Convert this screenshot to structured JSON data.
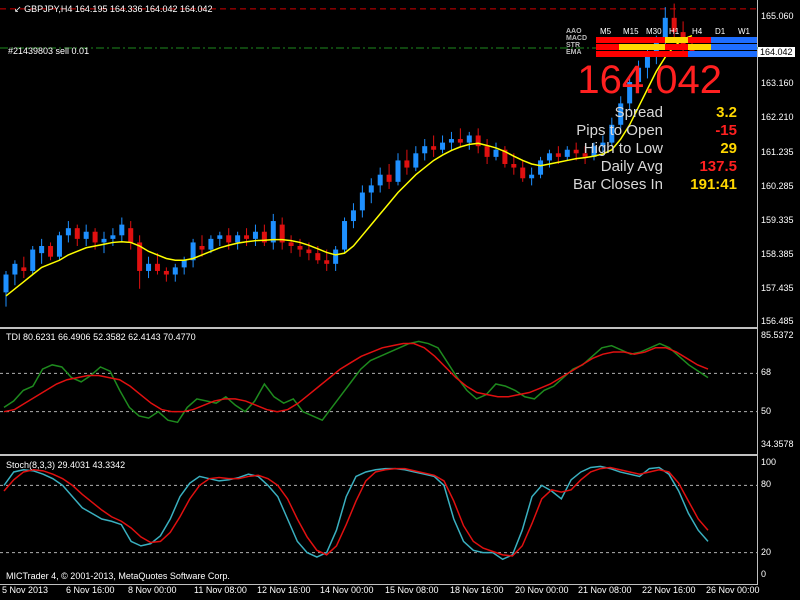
{
  "chart_data": {
    "type": "candlestick",
    "symbol_header": "GBPJPY,H4  164.195 164.336 164.042 164.042",
    "ylim": [
      156.3,
      165.5
    ],
    "y_ticks": [
      "165.060",
      "164.042",
      "163.160",
      "162.210",
      "161.235",
      "160.285",
      "159.335",
      "158.385",
      "157.435",
      "156.485"
    ],
    "x_ticks": [
      "5 Nov 2013",
      "6 Nov 16:00",
      "8 Nov 00:00",
      "11 Nov 08:00",
      "12 Nov 16:00",
      "14 Nov 00:00",
      "15 Nov 08:00",
      "18 Nov 16:00",
      "20 Nov 00:00",
      "21 Nov 08:00",
      "22 Nov 16:00",
      "26 Nov 00:00"
    ],
    "current_price": "164.042",
    "trade_label": "#21439803 sell 0.01",
    "candles": [
      {
        "o": 157.3,
        "h": 157.9,
        "l": 156.9,
        "c": 157.8
      },
      {
        "o": 157.8,
        "h": 158.2,
        "l": 157.5,
        "c": 158.1
      },
      {
        "o": 158.0,
        "h": 158.3,
        "l": 157.7,
        "c": 157.9
      },
      {
        "o": 157.9,
        "h": 158.6,
        "l": 157.8,
        "c": 158.5
      },
      {
        "o": 158.4,
        "h": 158.8,
        "l": 158.1,
        "c": 158.6
      },
      {
        "o": 158.6,
        "h": 158.7,
        "l": 158.2,
        "c": 158.3
      },
      {
        "o": 158.3,
        "h": 159.0,
        "l": 158.2,
        "c": 158.9
      },
      {
        "o": 158.9,
        "h": 159.3,
        "l": 158.7,
        "c": 159.1
      },
      {
        "o": 159.1,
        "h": 159.2,
        "l": 158.6,
        "c": 158.8
      },
      {
        "o": 158.8,
        "h": 159.2,
        "l": 158.6,
        "c": 159.0
      },
      {
        "o": 159.0,
        "h": 159.1,
        "l": 158.5,
        "c": 158.7
      },
      {
        "o": 158.7,
        "h": 159.0,
        "l": 158.4,
        "c": 158.8
      },
      {
        "o": 158.8,
        "h": 159.1,
        "l": 158.6,
        "c": 158.9
      },
      {
        "o": 158.9,
        "h": 159.4,
        "l": 158.7,
        "c": 159.2
      },
      {
        "o": 159.1,
        "h": 159.3,
        "l": 158.5,
        "c": 158.7
      },
      {
        "o": 158.7,
        "h": 158.9,
        "l": 157.4,
        "c": 157.9
      },
      {
        "o": 157.9,
        "h": 158.3,
        "l": 157.7,
        "c": 158.1
      },
      {
        "o": 158.1,
        "h": 158.4,
        "l": 157.8,
        "c": 157.9
      },
      {
        "o": 157.9,
        "h": 158.0,
        "l": 157.6,
        "c": 157.8
      },
      {
        "o": 157.8,
        "h": 158.1,
        "l": 157.6,
        "c": 158.0
      },
      {
        "o": 158.0,
        "h": 158.3,
        "l": 157.8,
        "c": 158.2
      },
      {
        "o": 158.2,
        "h": 158.8,
        "l": 158.0,
        "c": 158.7
      },
      {
        "o": 158.6,
        "h": 158.9,
        "l": 158.3,
        "c": 158.5
      },
      {
        "o": 158.5,
        "h": 158.9,
        "l": 158.4,
        "c": 158.8
      },
      {
        "o": 158.8,
        "h": 159.0,
        "l": 158.6,
        "c": 158.9
      },
      {
        "o": 158.9,
        "h": 159.1,
        "l": 158.5,
        "c": 158.7
      },
      {
        "o": 158.7,
        "h": 159.0,
        "l": 158.5,
        "c": 158.9
      },
      {
        "o": 158.9,
        "h": 159.1,
        "l": 158.6,
        "c": 158.8
      },
      {
        "o": 158.8,
        "h": 159.2,
        "l": 158.6,
        "c": 159.0
      },
      {
        "o": 159.0,
        "h": 159.2,
        "l": 158.6,
        "c": 158.7
      },
      {
        "o": 158.7,
        "h": 159.5,
        "l": 158.5,
        "c": 159.3
      },
      {
        "o": 159.2,
        "h": 159.4,
        "l": 158.5,
        "c": 158.7
      },
      {
        "o": 158.7,
        "h": 158.9,
        "l": 158.4,
        "c": 158.6
      },
      {
        "o": 158.6,
        "h": 158.8,
        "l": 158.3,
        "c": 158.5
      },
      {
        "o": 158.5,
        "h": 158.7,
        "l": 158.2,
        "c": 158.4
      },
      {
        "o": 158.4,
        "h": 158.6,
        "l": 158.1,
        "c": 158.2
      },
      {
        "o": 158.2,
        "h": 158.5,
        "l": 157.9,
        "c": 158.1
      },
      {
        "o": 158.1,
        "h": 158.6,
        "l": 157.9,
        "c": 158.5
      },
      {
        "o": 158.5,
        "h": 159.4,
        "l": 158.4,
        "c": 159.3
      },
      {
        "o": 159.3,
        "h": 159.8,
        "l": 159.1,
        "c": 159.6
      },
      {
        "o": 159.6,
        "h": 160.3,
        "l": 159.4,
        "c": 160.1
      },
      {
        "o": 160.1,
        "h": 160.5,
        "l": 159.8,
        "c": 160.3
      },
      {
        "o": 160.3,
        "h": 160.8,
        "l": 160.1,
        "c": 160.6
      },
      {
        "o": 160.6,
        "h": 160.9,
        "l": 160.2,
        "c": 160.4
      },
      {
        "o": 160.4,
        "h": 161.2,
        "l": 160.3,
        "c": 161.0
      },
      {
        "o": 161.0,
        "h": 161.3,
        "l": 160.6,
        "c": 160.8
      },
      {
        "o": 160.8,
        "h": 161.4,
        "l": 160.7,
        "c": 161.2
      },
      {
        "o": 161.2,
        "h": 161.6,
        "l": 161.0,
        "c": 161.4
      },
      {
        "o": 161.4,
        "h": 161.7,
        "l": 161.1,
        "c": 161.3
      },
      {
        "o": 161.3,
        "h": 161.7,
        "l": 161.2,
        "c": 161.5
      },
      {
        "o": 161.5,
        "h": 161.8,
        "l": 161.3,
        "c": 161.6
      },
      {
        "o": 161.6,
        "h": 161.9,
        "l": 161.4,
        "c": 161.5
      },
      {
        "o": 161.5,
        "h": 161.8,
        "l": 161.3,
        "c": 161.7
      },
      {
        "o": 161.7,
        "h": 161.9,
        "l": 161.2,
        "c": 161.4
      },
      {
        "o": 161.4,
        "h": 161.6,
        "l": 160.9,
        "c": 161.1
      },
      {
        "o": 161.1,
        "h": 161.5,
        "l": 161.0,
        "c": 161.3
      },
      {
        "o": 161.3,
        "h": 161.4,
        "l": 160.8,
        "c": 160.9
      },
      {
        "o": 160.9,
        "h": 161.2,
        "l": 160.6,
        "c": 160.8
      },
      {
        "o": 160.8,
        "h": 161.0,
        "l": 160.4,
        "c": 160.5
      },
      {
        "o": 160.5,
        "h": 160.8,
        "l": 160.3,
        "c": 160.6
      },
      {
        "o": 160.6,
        "h": 161.1,
        "l": 160.5,
        "c": 161.0
      },
      {
        "o": 161.0,
        "h": 161.3,
        "l": 160.8,
        "c": 161.2
      },
      {
        "o": 161.2,
        "h": 161.4,
        "l": 160.9,
        "c": 161.1
      },
      {
        "o": 161.1,
        "h": 161.4,
        "l": 161.0,
        "c": 161.3
      },
      {
        "o": 161.3,
        "h": 161.5,
        "l": 161.0,
        "c": 161.2
      },
      {
        "o": 161.2,
        "h": 161.4,
        "l": 160.9,
        "c": 161.1
      },
      {
        "o": 161.1,
        "h": 161.5,
        "l": 161.0,
        "c": 161.4
      },
      {
        "o": 161.4,
        "h": 161.7,
        "l": 161.2,
        "c": 161.5
      },
      {
        "o": 161.5,
        "h": 162.2,
        "l": 161.4,
        "c": 162.0
      },
      {
        "o": 162.0,
        "h": 162.8,
        "l": 161.9,
        "c": 162.6
      },
      {
        "o": 162.6,
        "h": 163.4,
        "l": 162.4,
        "c": 163.2
      },
      {
        "o": 163.2,
        "h": 163.8,
        "l": 163.0,
        "c": 163.6
      },
      {
        "o": 163.6,
        "h": 164.2,
        "l": 163.3,
        "c": 164.0
      },
      {
        "o": 164.0,
        "h": 164.5,
        "l": 163.7,
        "c": 164.3
      },
      {
        "o": 164.3,
        "h": 165.3,
        "l": 164.1,
        "c": 165.0
      },
      {
        "o": 165.0,
        "h": 165.4,
        "l": 164.4,
        "c": 164.6
      },
      {
        "o": 164.6,
        "h": 164.9,
        "l": 164.0,
        "c": 164.2
      },
      {
        "o": 164.2,
        "h": 164.4,
        "l": 163.9,
        "c": 164.04
      }
    ],
    "ma_line": [
      157.2,
      157.4,
      157.6,
      157.8,
      158.0,
      158.1,
      158.2,
      158.35,
      158.45,
      158.55,
      158.6,
      158.65,
      158.7,
      158.72,
      158.7,
      158.6,
      158.45,
      158.35,
      158.25,
      158.2,
      158.2,
      158.25,
      158.35,
      158.45,
      158.55,
      158.62,
      158.68,
      158.72,
      158.75,
      158.76,
      158.78,
      158.78,
      158.75,
      158.7,
      158.62,
      158.52,
      158.42,
      158.35,
      158.4,
      158.6,
      158.9,
      159.2,
      159.5,
      159.8,
      160.1,
      160.35,
      160.6,
      160.8,
      161.0,
      161.15,
      161.28,
      161.38,
      161.45,
      161.48,
      161.42,
      161.35,
      161.25,
      161.12,
      161.0,
      160.9,
      160.85,
      160.9,
      160.95,
      161.0,
      161.05,
      161.08,
      161.12,
      161.18,
      161.3,
      161.6,
      162.0,
      162.5,
      163.0,
      163.5,
      163.9,
      164.2,
      164.4,
      164.5
    ],
    "info_panel": {
      "price": "164.042",
      "rows": [
        {
          "label": "Spread",
          "value": "3.2",
          "color": "#ffd700"
        },
        {
          "label": "Pips to Open",
          "value": "-15",
          "color": "#ff2020"
        },
        {
          "label": "High to Low",
          "value": "29",
          "color": "#ffd700"
        },
        {
          "label": "Daily Avg",
          "value": "137.5",
          "color": "#ff2020"
        },
        {
          "label": "Bar Closes In",
          "value": "191:41",
          "color": "#ffd700"
        }
      ]
    },
    "mtf_panel": {
      "timeframes": [
        "M5",
        "M15",
        "M30",
        "H1",
        "H4",
        "D1",
        "W1"
      ],
      "rows": [
        {
          "label": "AAO",
          "cells": [
            "#000000",
            "#000000",
            "#000000",
            "#000000",
            "#000000",
            "#000000",
            "#000000"
          ]
        },
        {
          "label": "MACD",
          "cells": [
            "#ff0000",
            "#ff0000",
            "#ff0000",
            "#ffd700",
            "#ff0000",
            "#1e6eff",
            "#1e6eff"
          ]
        },
        {
          "label": "STR",
          "cells": [
            "#ff0000",
            "#ffd700",
            "#ffd700",
            "#ff0000",
            "#ffd700",
            "#1e6eff",
            "#1e6eff"
          ]
        },
        {
          "label": "EMA",
          "cells": [
            "#ff0000",
            "#ff0000",
            "#ff0000",
            "#ff0000",
            "#1e6eff",
            "#1e6eff",
            "#1e6eff"
          ]
        }
      ]
    }
  },
  "tdi": {
    "header": "TDI 80.6231 66.4906 52.3582 62.4143 70.4770",
    "y_ticks": [
      "85.5372",
      "68",
      "50",
      "34.3578"
    ],
    "ylim": [
      34.3578,
      85.5372
    ],
    "levels": [
      68,
      50
    ],
    "green": [
      52,
      55,
      60,
      62,
      70,
      72,
      71,
      66,
      64,
      67,
      71,
      69,
      60,
      52,
      48,
      47,
      50,
      46,
      45,
      52,
      56,
      55,
      54,
      57,
      53,
      50,
      55,
      63,
      57,
      54,
      56,
      50,
      48,
      46,
      52,
      58,
      64,
      70,
      74,
      76,
      78,
      80,
      82,
      83,
      82,
      80,
      73,
      66,
      60,
      56,
      58,
      63,
      62,
      60,
      57,
      56,
      60,
      62,
      66,
      70,
      72,
      76,
      80,
      81,
      79,
      77,
      78,
      80,
      82,
      80,
      76,
      72,
      69,
      66
    ],
    "red": [
      50,
      51,
      54,
      57,
      60,
      63,
      65,
      66,
      67,
      67,
      66,
      65,
      62,
      58,
      54,
      51,
      50,
      50,
      51,
      53,
      55,
      56,
      56,
      55,
      53,
      51,
      50,
      51,
      54,
      58,
      62,
      66,
      70,
      73,
      76,
      78,
      80,
      81,
      82,
      82,
      80,
      76,
      71,
      66,
      62,
      59,
      58,
      57,
      57,
      58,
      59,
      61,
      63,
      66,
      69,
      72,
      75,
      77,
      78,
      78,
      77,
      78,
      80,
      80,
      78,
      75,
      72,
      70
    ]
  },
  "stoch": {
    "header": "Stoch(8,3,3) 29.4031 43.3342",
    "y_ticks": [
      "100",
      "80",
      "20",
      "0"
    ],
    "ylim": [
      0,
      100
    ],
    "levels": [
      80,
      20
    ],
    "main": [
      80,
      92,
      94,
      93,
      90,
      86,
      80,
      70,
      60,
      55,
      50,
      48,
      45,
      30,
      26,
      28,
      35,
      50,
      70,
      82,
      88,
      86,
      84,
      85,
      87,
      90,
      88,
      80,
      70,
      50,
      30,
      20,
      16,
      20,
      40,
      70,
      88,
      92,
      94,
      95,
      95,
      94,
      92,
      90,
      88,
      80,
      50,
      30,
      22,
      20,
      20,
      14,
      18,
      40,
      70,
      80,
      75,
      68,
      85,
      92,
      96,
      97,
      95,
      92,
      90,
      88,
      95,
      96,
      90,
      75,
      55,
      40,
      30
    ],
    "signal": [
      75,
      85,
      92,
      94,
      93,
      90,
      86,
      80,
      72,
      65,
      58,
      52,
      48,
      42,
      34,
      29,
      30,
      38,
      52,
      68,
      80,
      86,
      87,
      86,
      86,
      88,
      89,
      86,
      80,
      68,
      50,
      34,
      22,
      18,
      26,
      45,
      66,
      84,
      92,
      94,
      95,
      95,
      93,
      91,
      89,
      84,
      66,
      44,
      30,
      24,
      21,
      18,
      17,
      26,
      46,
      68,
      76,
      74,
      76,
      85,
      92,
      95,
      96,
      94,
      92,
      90,
      92,
      94,
      92,
      82,
      66,
      50,
      40
    ]
  },
  "footer": "MICTrader 4, © 2001-2013, MetaQuotes Software Corp."
}
